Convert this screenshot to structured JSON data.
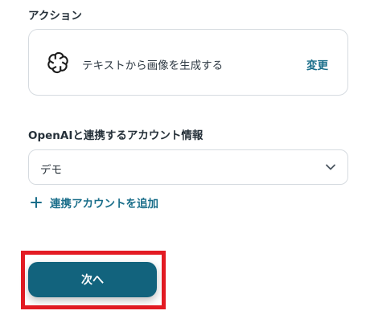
{
  "action": {
    "section_label": "アクション",
    "card_text": "テキストから画像を生成する",
    "change_label": "変更",
    "logo_icon": "openai-logo-icon"
  },
  "account": {
    "section_label": "OpenAIと連携するアカウント情報",
    "selected_value": "デモ",
    "add_label": "連携アカウントを追加"
  },
  "footer": {
    "next_label": "次へ"
  },
  "colors": {
    "accent": "#1a6e8a",
    "button": "#12637d",
    "highlight": "#e31b23"
  }
}
